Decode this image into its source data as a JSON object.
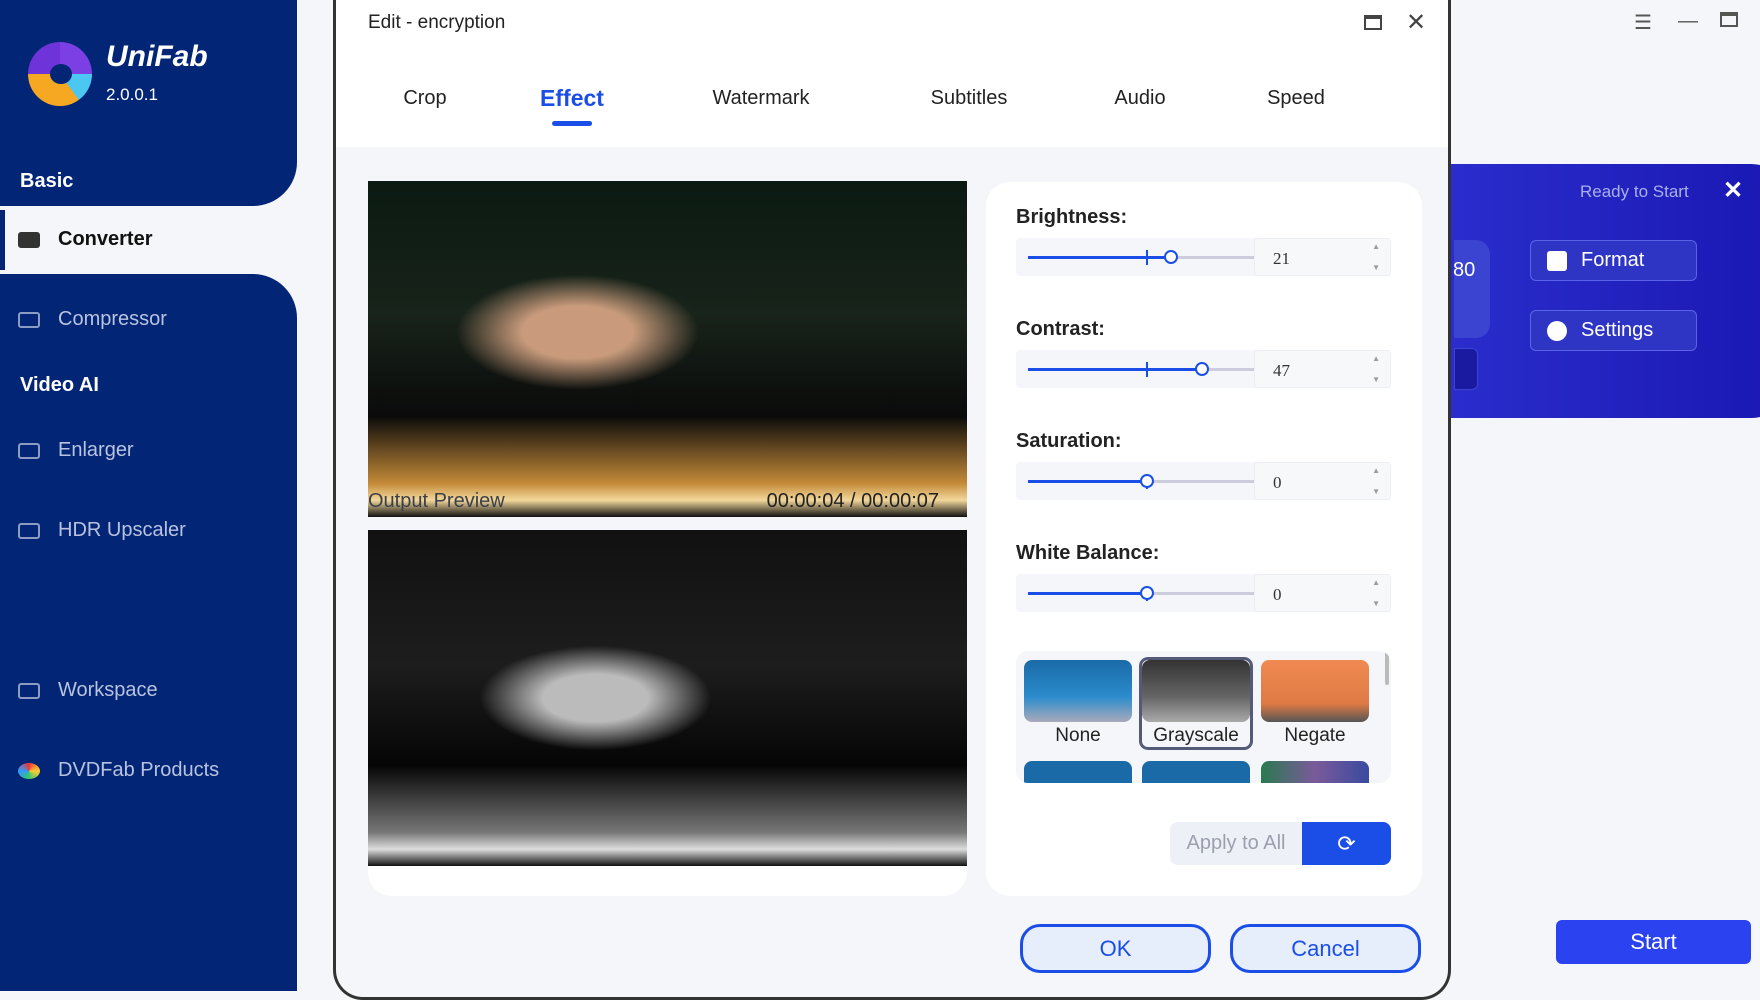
{
  "app": {
    "brand": "UniFab",
    "version": "2.0.0.1"
  },
  "sidebar": {
    "sections": [
      "Basic",
      "Video AI"
    ],
    "items": [
      {
        "label": "Converter",
        "icon": "play-icon",
        "active": true
      },
      {
        "label": "Compressor",
        "icon": "compress-icon"
      },
      {
        "label": "Enlarger",
        "icon": "enlarge-icon"
      },
      {
        "label": "HDR Upscaler",
        "icon": "hdr-icon"
      },
      {
        "label": "Workspace",
        "icon": "monitor-icon"
      },
      {
        "label": "DVDFab Products",
        "icon": "dvdfab-icon"
      }
    ]
  },
  "dialog": {
    "title": "Edit - encryption",
    "tabs": [
      "Crop",
      "Effect",
      "Watermark",
      "Subtitles",
      "Audio",
      "Speed"
    ],
    "active_tab": "Effect",
    "preview": {
      "label": "Output Preview",
      "time": "00:00:04 / 00:00:07"
    },
    "adjust": [
      {
        "label": "Brightness:",
        "value": 21
      },
      {
        "label": "Contrast:",
        "value": 47
      },
      {
        "label": "Saturation:",
        "value": 0
      },
      {
        "label": "White Balance:",
        "value": 0
      }
    ],
    "range": [
      -100,
      100
    ],
    "filters": [
      {
        "name": "None"
      },
      {
        "name": "Grayscale",
        "selected": true
      },
      {
        "name": "Negate"
      }
    ],
    "apply_all": "Apply to All",
    "ok": "OK",
    "cancel": "Cancel",
    "accent": "#1a4ee6"
  },
  "right": {
    "status": "Ready to Start",
    "partial": "80",
    "format": "Format",
    "settings": "Settings",
    "start": "Start"
  }
}
